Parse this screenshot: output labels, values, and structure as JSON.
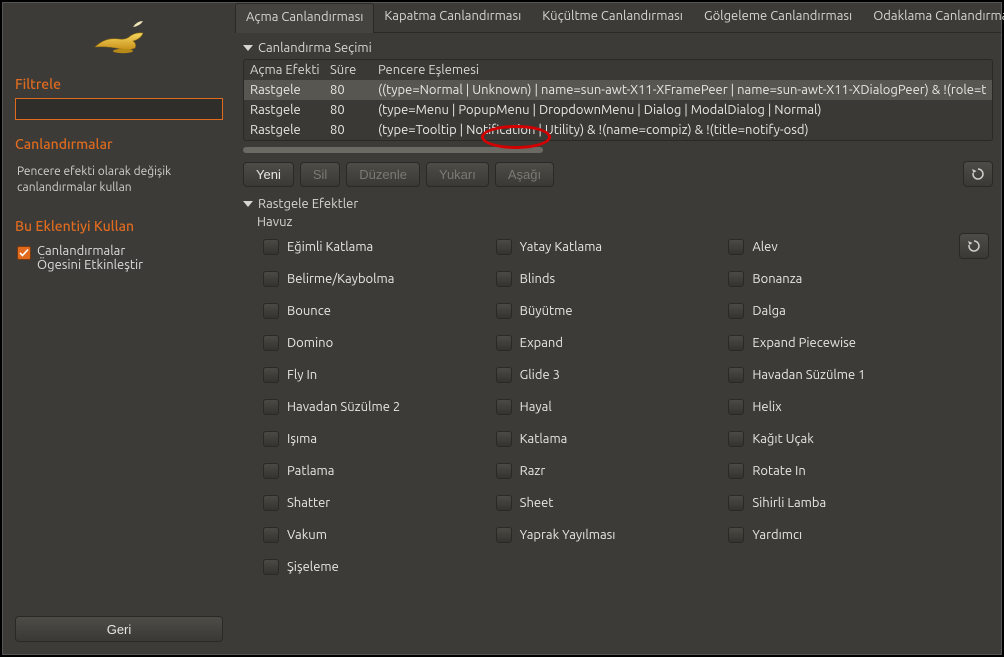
{
  "sidebar": {
    "filter_label": "Filtrele",
    "filter_value": "",
    "section_anim": "Canlandırmalar",
    "desc": "Pencere efekti olarak değişik canlandırmalar kullan",
    "use_plugin": "Bu Eklentiyi Kullan",
    "checkbox_line1": "Canlandırmalar",
    "checkbox_line2": "Ögesini Etkinleştir",
    "back": "Geri"
  },
  "tabs": {
    "items": [
      "Açma Canlandırması",
      "Kapatma Canlandırması",
      "Küçültme Canlandırması",
      "Gölgeleme Canlandırması",
      "Odaklama Canlandırması"
    ],
    "active": 0
  },
  "section1": "Canlandırma Seçimi",
  "table": {
    "headers": {
      "effect": "Açma Efekti",
      "duration": "Süre",
      "match": "Pencere Eşlemesi"
    },
    "rows": [
      {
        "effect": "Rastgele",
        "duration": "80",
        "match": "((type=Normal | Unknown) | name=sun-awt-X11-XFramePeer | name=sun-awt-X11-XDialogPeer) & !(role=toolTip"
      },
      {
        "effect": "Rastgele",
        "duration": "80",
        "match": "(type=Menu | PopupMenu | DropdownMenu | Dialog | ModalDialog | Normal)"
      },
      {
        "effect": "Rastgele",
        "duration": "80",
        "match": "(type=Tooltip | Notification | Utility) & !(name=compiz) & !(title=notify-osd)"
      }
    ]
  },
  "toolbar": {
    "new": "Yeni",
    "delete": "Sil",
    "edit": "Düzenle",
    "up": "Yukarı",
    "down": "Aşağı"
  },
  "section2": "Rastgele Efektler",
  "pool_label": "Havuz",
  "effects": {
    "col1": [
      "Eğimli Katlama",
      "Belirme/Kaybolma",
      "Bounce",
      "Domino",
      "Fly In",
      "Havadan Süzülme 2",
      "Işıma",
      "Patlama",
      "Shatter",
      "Vakum",
      "Şişeleme"
    ],
    "col2": [
      "Yatay Katlama",
      "Blinds",
      "Büyütme",
      "Expand",
      "Glide 3",
      "Hayal",
      "Katlama",
      "Razr",
      "Sheet",
      "Yaprak Yayılması"
    ],
    "col3": [
      "Alev",
      "Bonanza",
      "Dalga",
      "Expand Piecewise",
      "Havadan Süzülme 1",
      "Helix",
      "Kağıt Uçak",
      "Rotate In",
      "Sihirli Lamba",
      "Yardımcı"
    ]
  }
}
